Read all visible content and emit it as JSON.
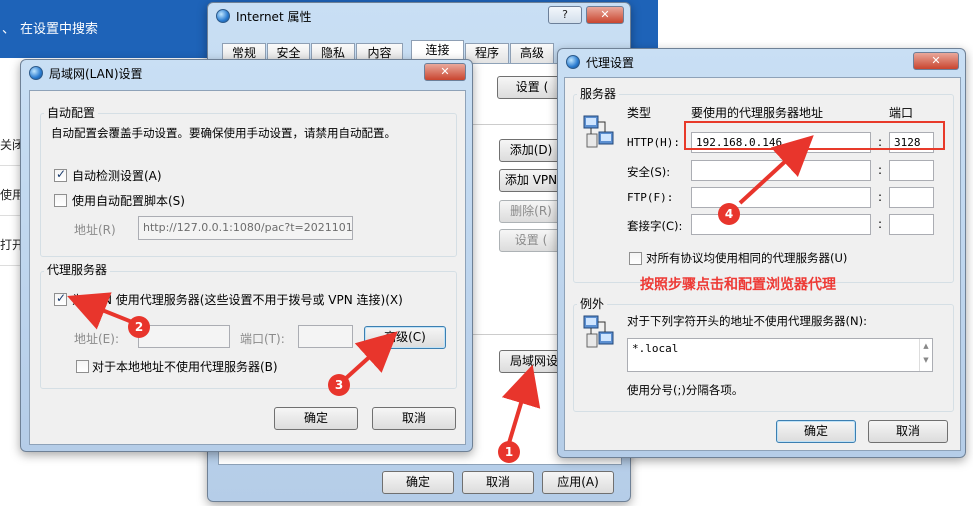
{
  "settings": {
    "back_label": "、",
    "search_placeholder": "在设置中搜索",
    "side": [
      "关闭",
      "使用",
      "打开"
    ]
  },
  "internet": {
    "title": "Internet 属性",
    "title_buttons": {
      "help": "?",
      "close": "✕"
    },
    "tabs": [
      "常规",
      "安全",
      "隐私",
      "内容",
      "连接",
      "程序",
      "高级"
    ],
    "active_tab": "连接",
    "setup_label": "设置 (",
    "add_label": "添加(D)",
    "add_vpn_label": "添加 VPN",
    "delete_label": "删除(R)",
    "settings_label": "设置 (",
    "lan_settings_label": "局域网设",
    "ok": "确定",
    "cancel": "取消",
    "apply": "应用(A)"
  },
  "lan": {
    "title": "局域网(LAN)设置",
    "close_label": "✕",
    "auto_group": "自动配置",
    "auto_desc": "自动配置会覆盖手动设置。要确保使用手动设置，请禁用自动配置。",
    "auto_detect": {
      "label": "自动检测设置(A)",
      "checked": true
    },
    "auto_script": {
      "label": "使用自动配置脚本(S)",
      "checked": false
    },
    "address_label": "地址(R)",
    "address_value": "http://127.0.0.1:1080/pac?t=2021101",
    "proxy_group": "代理服务器",
    "use_proxy": {
      "label": "为 LAN 使用代理服务器(这些设置不用于拨号或 VPN 连接)(X)",
      "checked": true
    },
    "proxy_address_label": "地址(E):",
    "port_label": "端口(T):",
    "advanced_label": "高级(C)",
    "bypass_local": {
      "label": "对于本地地址不使用代理服务器(B)",
      "checked": false
    },
    "ok": "确定",
    "cancel": "取消"
  },
  "proxy": {
    "title": "代理设置",
    "close_label": "✕",
    "servers_group": "服务器",
    "col_type": "类型",
    "col_address": "要使用的代理服务器地址",
    "col_port": "端口",
    "rows": [
      {
        "label": "HTTP(H):",
        "address": "192.168.0.146",
        "port": "3128"
      },
      {
        "label": "安全(S):",
        "address": "",
        "port": ""
      },
      {
        "label": "FTP(F):",
        "address": "",
        "port": ""
      },
      {
        "label": "套接字(C):",
        "address": "",
        "port": ""
      }
    ],
    "colon": ":",
    "same_proxy": {
      "label": "对所有协议均使用相同的代理服务器(U)",
      "checked": false
    },
    "exceptions_group": "例外",
    "exceptions_desc": "对于下列字符开头的地址不使用代理服务器(N):",
    "exceptions_value": "*.local",
    "semicolon_hint": "使用分号(;)分隔各项。",
    "ok": "确定",
    "cancel": "取消"
  },
  "annotations": {
    "note": "按照步骤点击和配置浏览器代理",
    "badges": [
      "1",
      "2",
      "3",
      "4"
    ],
    "color": "#e8352c"
  }
}
